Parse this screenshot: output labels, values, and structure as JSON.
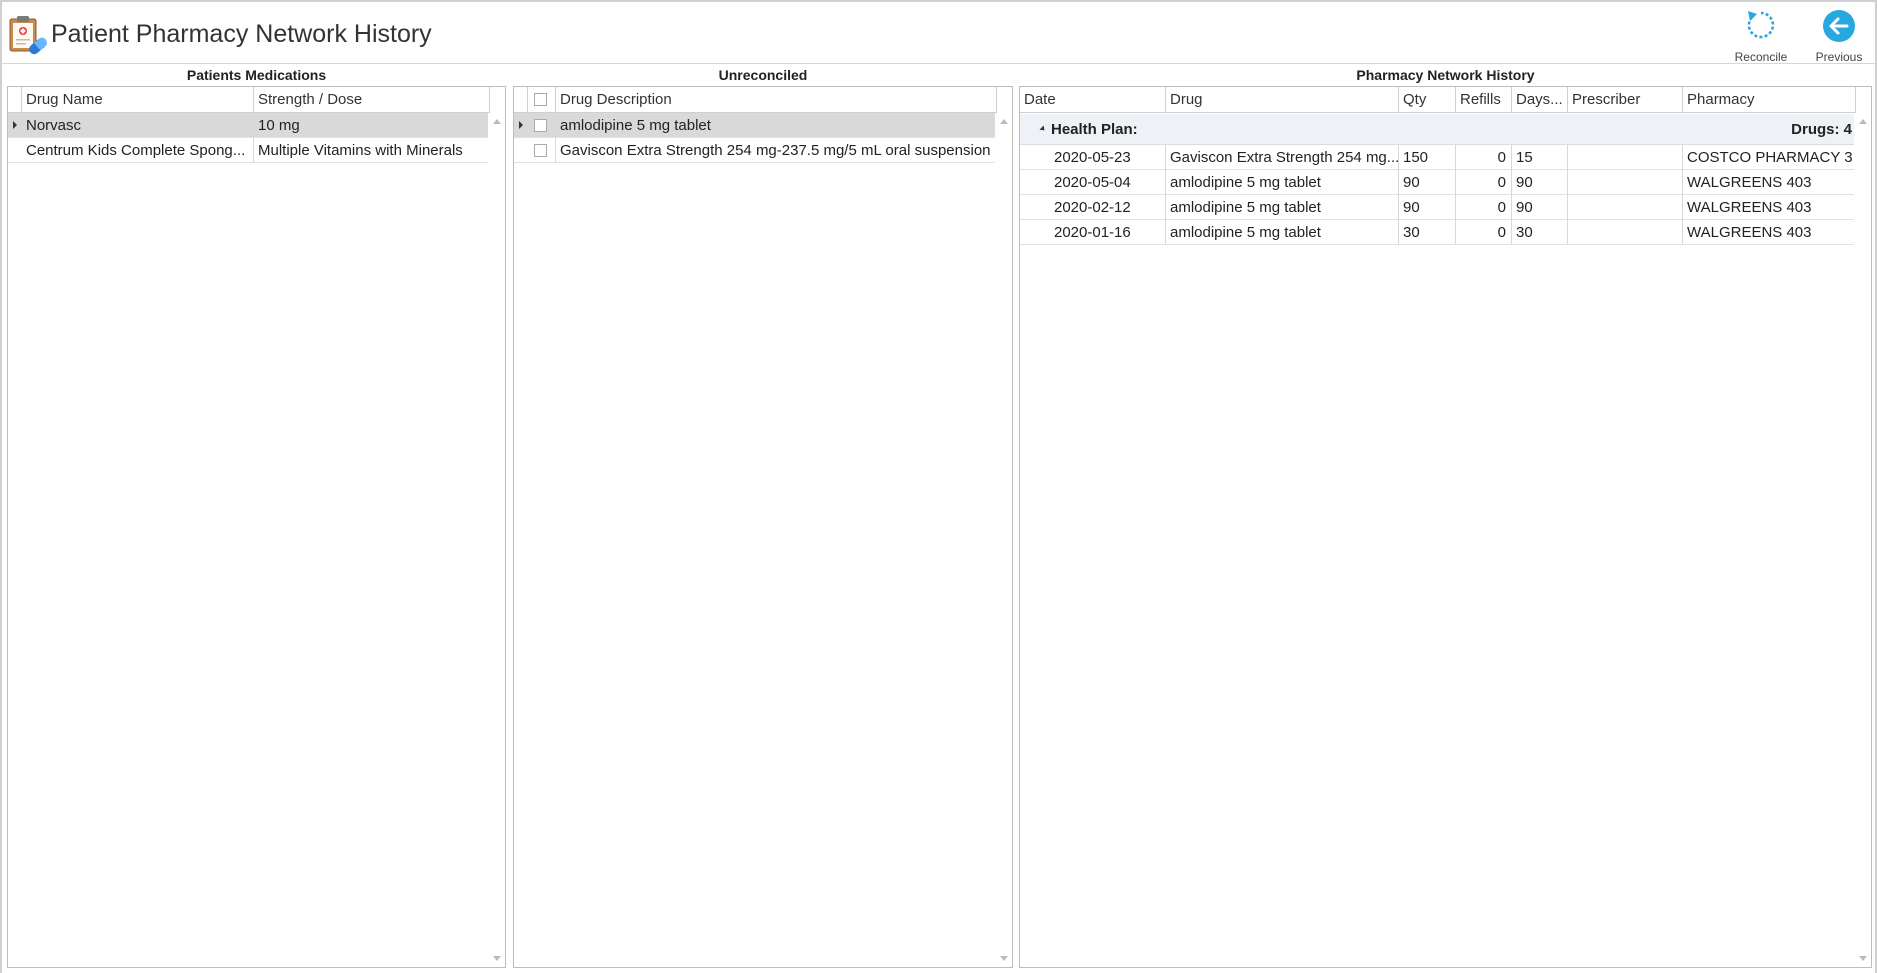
{
  "header": {
    "title": "Patient Pharmacy Network History",
    "reconcile_label": "Reconcile",
    "previous_label": "Previous"
  },
  "colors": {
    "accent": "#29a8e0",
    "selected_row": "#d9d9d9",
    "group_bg": "#eef2f7"
  },
  "meds": {
    "title": "Patients Medications",
    "columns": [
      "Drug Name",
      "Strength / Dose"
    ],
    "rows": [
      {
        "name": "Norvasc",
        "dose": "10 mg",
        "selected": true
      },
      {
        "name": "Centrum Kids Complete Spong...",
        "dose": "Multiple Vitamins with Minerals",
        "selected": false
      }
    ]
  },
  "unrec": {
    "title": "Unreconciled",
    "columns": [
      "Drug Description"
    ],
    "rows": [
      {
        "desc": "amlodipine 5 mg tablet",
        "selected": true
      },
      {
        "desc": "Gaviscon Extra Strength 254 mg-237.5 mg/5 mL oral suspension",
        "selected": false
      }
    ]
  },
  "history": {
    "title": "Pharmacy Network History",
    "columns": [
      "Date",
      "Drug",
      "Qty",
      "Refills",
      "Days...",
      "Prescriber",
      "Pharmacy"
    ],
    "group_label": "Health Plan:",
    "group_count": "Drugs: 4",
    "rows": [
      {
        "date": "2020-05-23",
        "drug": "Gaviscon Extra Strength 254 mg...",
        "qty": "150",
        "refills": "0",
        "days": "15",
        "prescriber": "",
        "pharmacy": "COSTCO PHARMACY 3..."
      },
      {
        "date": "2020-05-04",
        "drug": "amlodipine 5 mg tablet",
        "qty": "90",
        "refills": "0",
        "days": "90",
        "prescriber": "",
        "pharmacy": "WALGREENS 403"
      },
      {
        "date": "2020-02-12",
        "drug": "amlodipine 5 mg tablet",
        "qty": "90",
        "refills": "0",
        "days": "90",
        "prescriber": "",
        "pharmacy": "WALGREENS 403"
      },
      {
        "date": "2020-01-16",
        "drug": "amlodipine 5 mg tablet",
        "qty": "30",
        "refills": "0",
        "days": "30",
        "prescriber": "",
        "pharmacy": "WALGREENS 403"
      }
    ]
  }
}
